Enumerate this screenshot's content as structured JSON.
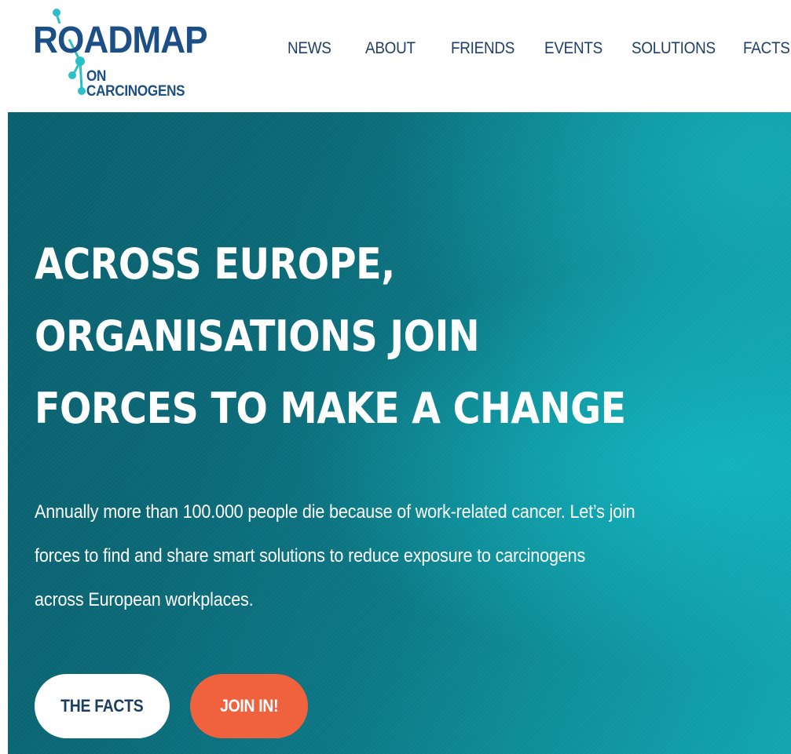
{
  "logo": {
    "wordmark": "ROADMAP",
    "subline": "ON CARCINOGENS",
    "colors": {
      "text": "#1b4f86",
      "molecule": "#2bc0c6"
    }
  },
  "nav": {
    "items": [
      {
        "label": "NEWS"
      },
      {
        "label": "ABOUT"
      },
      {
        "label": "FRIENDS"
      },
      {
        "label": "EVENTS"
      },
      {
        "label": "SOLUTIONS"
      },
      {
        "label": "FACTS"
      }
    ]
  },
  "hero": {
    "title_lines": [
      "ACROSS EUROPE,",
      "ORGANISATIONS JOIN",
      "FORCES TO MAKE A CHANGE"
    ],
    "text_lines": [
      "Annually more than 100.000 people die because of work-related cancer. Let’s join",
      "forces to find and share smart solutions to reduce exposure to carcinogens",
      "across European workplaces."
    ],
    "buttons": {
      "facts": "THE FACTS",
      "join": "JOIN IN!"
    },
    "colors": {
      "background": "#0b6876",
      "accent": "#f0623e",
      "button_text": "#1d3e63"
    }
  }
}
